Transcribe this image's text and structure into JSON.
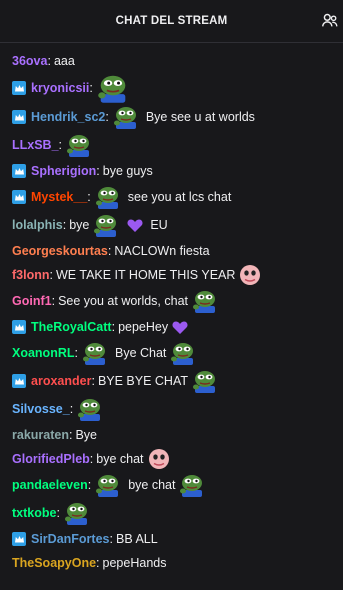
{
  "header": {
    "title": "CHAT DEL STREAM",
    "icon": "users-icon"
  },
  "messages": [
    {
      "user": "36ova",
      "color": "#a970ff",
      "badge": false,
      "parts": [
        {
          "t": "text",
          "v": "aaa"
        }
      ]
    },
    {
      "user": "kryonicsii",
      "color": "#a970ff",
      "badge": true,
      "parts": [
        {
          "t": "emote",
          "v": "pepe-big"
        }
      ]
    },
    {
      "user": "Hendrik_sc2",
      "color": "#5b9bd5",
      "badge": true,
      "parts": [
        {
          "t": "emote",
          "v": "pepe-hands"
        },
        {
          "t": "text",
          "v": "Bye see u at worlds"
        }
      ]
    },
    {
      "user": "LLxSB_",
      "color": "#a970ff",
      "badge": false,
      "parts": [
        {
          "t": "emote",
          "v": "pepe-hands"
        }
      ]
    },
    {
      "user": "Spherigion",
      "color": "#a970ff",
      "badge": true,
      "parts": [
        {
          "t": "text",
          "v": "bye guys"
        }
      ]
    },
    {
      "user": "Mystek__",
      "color": "#ff4500",
      "badge": true,
      "parts": [
        {
          "t": "emote",
          "v": "pepe-hands"
        },
        {
          "t": "text",
          "v": "see you at lcs chat"
        }
      ]
    },
    {
      "user": "lolalphis",
      "color": "#8ab4b5",
      "badge": false,
      "parts": [
        {
          "t": "text",
          "v": "bye"
        },
        {
          "t": "emote",
          "v": "pepe-hands"
        },
        {
          "t": "emote",
          "v": "heart"
        },
        {
          "t": "text",
          "v": "EU"
        }
      ]
    },
    {
      "user": "Georgeskourtas",
      "color": "#ff7f50",
      "badge": false,
      "parts": [
        {
          "t": "text",
          "v": "NACLOWn fiesta"
        }
      ]
    },
    {
      "user": "f3lonn",
      "color": "#ff6a6a",
      "badge": false,
      "parts": [
        {
          "t": "text",
          "v": "WE TAKE IT HOME THIS YEAR"
        },
        {
          "t": "emote",
          "v": "face"
        }
      ]
    },
    {
      "user": "Goinf1",
      "color": "#ff69b4",
      "badge": false,
      "parts": [
        {
          "t": "text",
          "v": "See you at worlds, chat"
        },
        {
          "t": "emote",
          "v": "pepe-hands"
        }
      ]
    },
    {
      "user": "TheRoyalCatt",
      "color": "#00ff7f",
      "badge": true,
      "parts": [
        {
          "t": "text",
          "v": "pepeHey"
        },
        {
          "t": "emote",
          "v": "heart"
        }
      ]
    },
    {
      "user": "XoanonRL",
      "color": "#00ff7f",
      "badge": false,
      "parts": [
        {
          "t": "emote",
          "v": "pepe-hands"
        },
        {
          "t": "text",
          "v": "Bye Chat"
        },
        {
          "t": "emote",
          "v": "pepe-hands"
        }
      ]
    },
    {
      "user": "aroxander",
      "color": "#ff4f4f",
      "badge": true,
      "parts": [
        {
          "t": "text",
          "v": "BYE BYE CHAT"
        },
        {
          "t": "emote",
          "v": "pepe-hands"
        }
      ]
    },
    {
      "user": "Silvosse_",
      "color": "#69b4ff",
      "badge": false,
      "parts": [
        {
          "t": "emote",
          "v": "pepe-hands"
        }
      ]
    },
    {
      "user": "rakuraten",
      "color": "#8aa8a8",
      "badge": false,
      "parts": [
        {
          "t": "text",
          "v": "Bye"
        }
      ]
    },
    {
      "user": "GlorifiedPleb",
      "color": "#a970ff",
      "badge": false,
      "parts": [
        {
          "t": "text",
          "v": "bye chat"
        },
        {
          "t": "emote",
          "v": "face"
        }
      ]
    },
    {
      "user": "pandaeleven",
      "color": "#00ff7f",
      "badge": false,
      "parts": [
        {
          "t": "emote",
          "v": "pepe-hands"
        },
        {
          "t": "text",
          "v": "bye chat"
        },
        {
          "t": "emote",
          "v": "pepe-hands"
        }
      ]
    },
    {
      "user": "txtkobe",
      "color": "#00ff7f",
      "badge": false,
      "parts": [
        {
          "t": "emote",
          "v": "pepe-hands"
        }
      ]
    },
    {
      "user": "SirDanFortes",
      "color": "#5b9bd5",
      "badge": true,
      "parts": [
        {
          "t": "text",
          "v": "BB ALL"
        }
      ]
    },
    {
      "user": "TheSoapyOne",
      "color": "#daa520",
      "badge": false,
      "parts": [
        {
          "t": "text",
          "v": "pepeHands"
        }
      ]
    }
  ]
}
